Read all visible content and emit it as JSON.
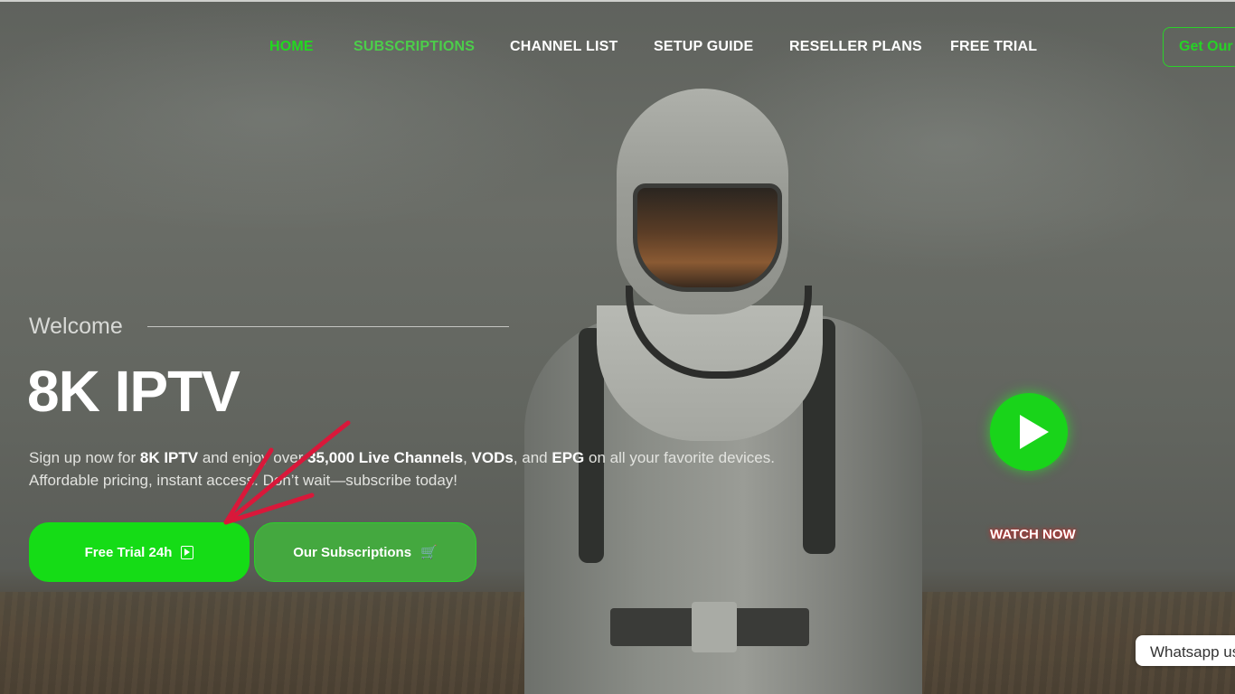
{
  "nav": {
    "items": [
      {
        "label": "HOME",
        "color": "#22d820"
      },
      {
        "label": "SUBSCRIPTIONS",
        "color": "#4ccd4a"
      },
      {
        "label": "CHANNEL LIST"
      },
      {
        "label": "SETUP GUIDE"
      },
      {
        "label": "RESELLER PLANS"
      },
      {
        "label": "FREE TRIAL"
      }
    ],
    "cta_label": "Get Our"
  },
  "hero": {
    "welcome": "Welcome",
    "title": "8K IPTV",
    "desc": {
      "t1": "Sign up now for ",
      "b1": "8K IPTV",
      "t2": " and enjoy over ",
      "b2": "35,000 Live Channels",
      "t3": ", ",
      "b3": "VODs",
      "t4": ", and ",
      "b4": "EPG",
      "t5": " on all your favorite devices.",
      "line2": "Affordable pricing, instant access. Don’t wait—subscribe today!"
    },
    "buttons": {
      "trial_label": "Free Trial 24h",
      "subs_label": "Our Subscriptions"
    }
  },
  "watch": {
    "label": "WATCH NOW"
  },
  "whatsapp": {
    "label": "Whatsapp us"
  },
  "colors": {
    "accent": "#15dc16",
    "accent_dark": "#44a83f",
    "annotation": "#d9183a"
  },
  "icons": [
    "play-square-icon",
    "cart-icon",
    "play-icon",
    "annotation-arrow-icon"
  ]
}
